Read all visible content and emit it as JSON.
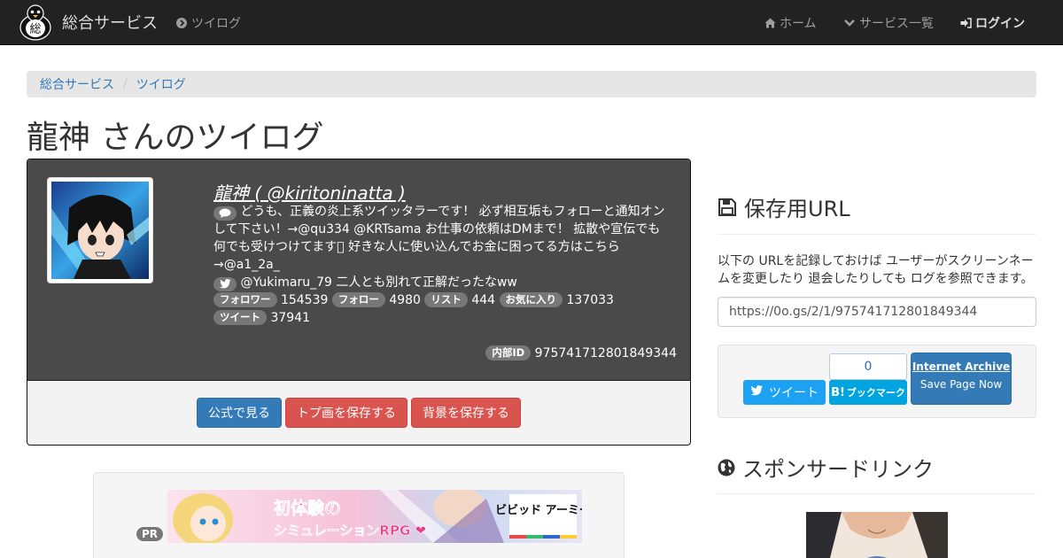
{
  "navbar": {
    "brand": "総合サービス",
    "link_tsuilog": "ツイログ",
    "home": "ホーム",
    "services": "サービス一覧",
    "login": "ログイン",
    "logo_char": "総"
  },
  "breadcrumb": {
    "items": [
      "総合サービス",
      "ツイログ"
    ],
    "separator": "/"
  },
  "page_title": "龍神 さんのツイログ",
  "profile": {
    "name": "龍神 ( @kiritoninatta )",
    "bio": "どうも、正義の炎上系ツイッタラーです！ 必ず相互垢もフォローと通知オンして下さい！→@qu334 @KRTsama お仕事の依頼はDMまで！ 拡散や宣伝でも何でも受けつけてます󾭟 好きな人に使い込んでお金に困ってる方はこちら→@a1_2a_",
    "latest_tweet": "@Yukimaru_79 二人とも別れて正解だったなww",
    "stats": {
      "followers_label": "フォロワー",
      "followers": "154539",
      "following_label": "フォロー",
      "following": "4980",
      "lists_label": "リスト",
      "lists": "444",
      "favorites_label": "お気に入り",
      "favorites": "137033",
      "tweets_label": "ツイート",
      "tweets": "37941"
    },
    "internal_id_label": "内部ID",
    "internal_id": "975741712801849344"
  },
  "actions": {
    "official": "公式で見る",
    "save_icon": "トプ画を保存する",
    "save_bg": "背景を保存する"
  },
  "ad": {
    "pr_badge": "PR",
    "banner_line1": "初体験の",
    "banner_line2": "シミュレーションRPG ❤",
    "banner_logo": "ビビッド アーミー",
    "banner_colors": [
      "#f3c6dc",
      "#e86aa8",
      "#2f2f2f"
    ]
  },
  "sidebar": {
    "save_url_title": "保存用URL",
    "save_url_desc": "以下の URLを記録しておけば ユーザーがスクリーンネームを変更したり 退会したりしても ログを参照できます。",
    "save_url_value": "https://0o.gs/2/1/975741712801849344",
    "tweet_button": "ツイート",
    "hatena_count": "0",
    "hatena_button": "ブックマーク",
    "archive_title": "Internet Archive",
    "archive_sub": "Save Page Now",
    "sponsor_title": "スポンサードリンク"
  },
  "colors": {
    "navbar": "#222222",
    "link": "#337ab7",
    "danger": "#d9534f",
    "twitter": "#1da1f2",
    "hatena": "#00a4de"
  }
}
